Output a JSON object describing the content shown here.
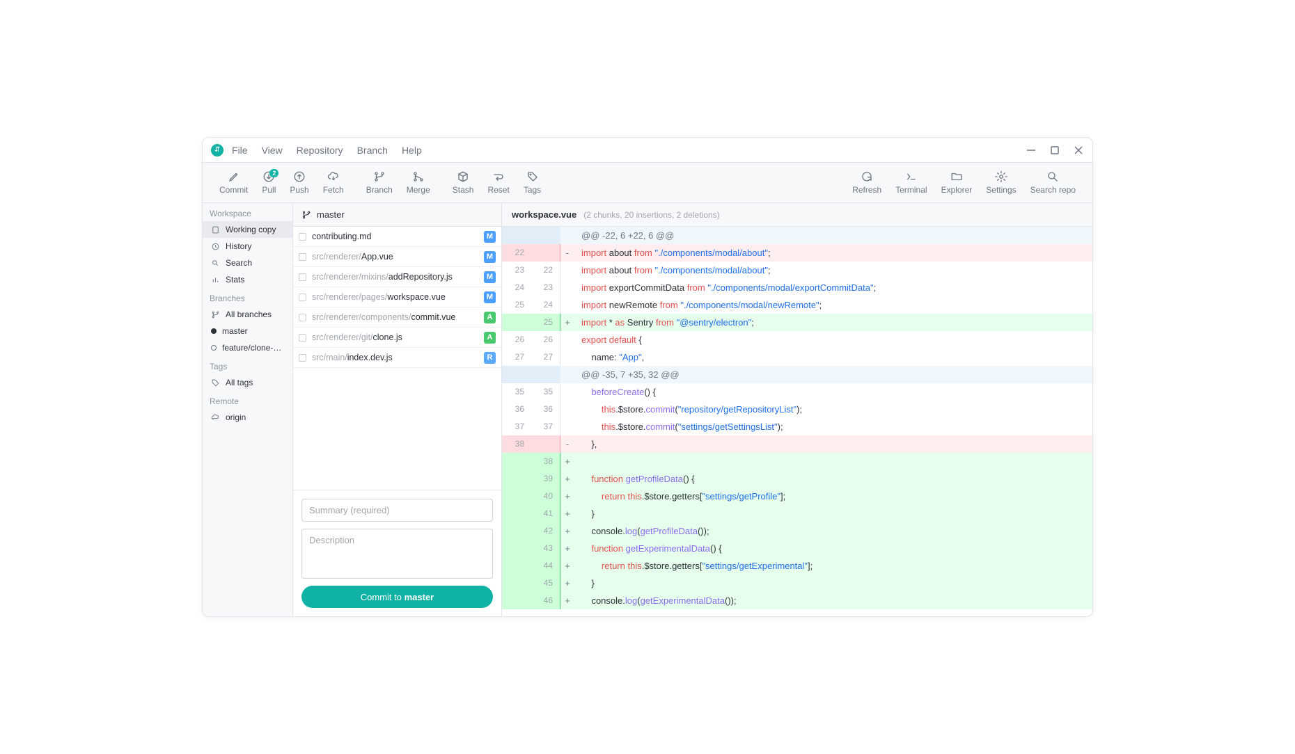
{
  "menu": {
    "file": "File",
    "view": "View",
    "repository": "Repository",
    "branch": "Branch",
    "help": "Help"
  },
  "toolbar": {
    "commit": "Commit",
    "pull": "Pull",
    "pull_badge": "2",
    "push": "Push",
    "fetch": "Fetch",
    "branch": "Branch",
    "merge": "Merge",
    "stash": "Stash",
    "reset": "Reset",
    "tags": "Tags",
    "refresh": "Refresh",
    "terminal": "Terminal",
    "explorer": "Explorer",
    "settings": "Settings",
    "search": "Search repo"
  },
  "sidebar": {
    "workspace_title": "Workspace",
    "working_copy": "Working copy",
    "history": "History",
    "search": "Search",
    "stats": "Stats",
    "branches_title": "Branches",
    "all_branches": "All branches",
    "branch_master": "master",
    "branch_feature": "feature/clone-re...",
    "tags_title": "Tags",
    "all_tags": "All tags",
    "remote_title": "Remote",
    "origin": "origin"
  },
  "filepanel": {
    "branch": "master",
    "files": [
      {
        "dim": "",
        "name": "contributing.md",
        "status": "M",
        "selected": false
      },
      {
        "dim": "src/renderer/",
        "name": "App.vue",
        "status": "M",
        "selected": true
      },
      {
        "dim": "src/renderer/mixins/",
        "name": "addRepository.js",
        "status": "M",
        "selected": false
      },
      {
        "dim": "src/renderer/pages/",
        "name": "workspace.vue",
        "status": "M",
        "selected": false
      },
      {
        "dim": "src/renderer/components/",
        "name": "commit.vue",
        "status": "A",
        "selected": false
      },
      {
        "dim": "src/renderer/git/",
        "name": "clone.js",
        "status": "A",
        "selected": false
      },
      {
        "dim": "src/main/",
        "name": "index.dev.js",
        "status": "R",
        "selected": false
      }
    ],
    "summary_ph": "Summary (required)",
    "desc_ph": "Description",
    "commit_prefix": "Commit to ",
    "commit_branch": "master"
  },
  "diff": {
    "filename": "workspace.vue",
    "meta": "(2 chunks, 20 insertions, 2 deletions)",
    "lines": [
      {
        "type": "hunk",
        "old": "",
        "new": "",
        "sign": "",
        "tokens": [
          {
            "cls": "tok-dim",
            "t": "@@ -22, 6 +22, 6 @@"
          }
        ]
      },
      {
        "type": "del",
        "old": "22",
        "new": "",
        "sign": "-",
        "tokens": [
          {
            "cls": "tok-kw",
            "t": "import"
          },
          {
            "cls": "tok-plain",
            "t": " about "
          },
          {
            "cls": "tok-kw",
            "t": "from"
          },
          {
            "cls": "tok-plain",
            "t": " "
          },
          {
            "cls": "tok-str",
            "t": "\"./components/modal/about\""
          },
          {
            "cls": "tok-plain",
            "t": ";"
          }
        ]
      },
      {
        "type": "ctx",
        "old": "23",
        "new": "22",
        "sign": "",
        "tokens": [
          {
            "cls": "tok-kw",
            "t": "import"
          },
          {
            "cls": "tok-plain",
            "t": " about "
          },
          {
            "cls": "tok-kw",
            "t": "from"
          },
          {
            "cls": "tok-plain",
            "t": " "
          },
          {
            "cls": "tok-str",
            "t": "\"./components/modal/about\""
          },
          {
            "cls": "tok-plain",
            "t": ";"
          }
        ]
      },
      {
        "type": "ctx",
        "old": "24",
        "new": "23",
        "sign": "",
        "tokens": [
          {
            "cls": "tok-kw",
            "t": "import"
          },
          {
            "cls": "tok-plain",
            "t": " exportCommitData "
          },
          {
            "cls": "tok-kw",
            "t": "from"
          },
          {
            "cls": "tok-plain",
            "t": " "
          },
          {
            "cls": "tok-str",
            "t": "\"./components/modal/exportCommitData\""
          },
          {
            "cls": "tok-plain",
            "t": ";"
          }
        ]
      },
      {
        "type": "ctx",
        "old": "25",
        "new": "24",
        "sign": "",
        "tokens": [
          {
            "cls": "tok-kw",
            "t": "import"
          },
          {
            "cls": "tok-plain",
            "t": " newRemote "
          },
          {
            "cls": "tok-kw",
            "t": "from"
          },
          {
            "cls": "tok-plain",
            "t": " "
          },
          {
            "cls": "tok-str",
            "t": "\"./components/modal/newRemote\""
          },
          {
            "cls": "tok-plain",
            "t": ";"
          }
        ]
      },
      {
        "type": "add",
        "old": "",
        "new": "25",
        "sign": "+",
        "tokens": [
          {
            "cls": "tok-kw",
            "t": "import"
          },
          {
            "cls": "tok-plain",
            "t": " * "
          },
          {
            "cls": "tok-kw",
            "t": "as"
          },
          {
            "cls": "tok-plain",
            "t": " Sentry "
          },
          {
            "cls": "tok-kw",
            "t": "from"
          },
          {
            "cls": "tok-plain",
            "t": " "
          },
          {
            "cls": "tok-str",
            "t": "\"@sentry/electron\""
          },
          {
            "cls": "tok-plain",
            "t": ";"
          }
        ]
      },
      {
        "type": "ctx",
        "old": "26",
        "new": "26",
        "sign": "",
        "tokens": [
          {
            "cls": "tok-kw",
            "t": "export default"
          },
          {
            "cls": "tok-plain",
            "t": " {"
          }
        ]
      },
      {
        "type": "ctx",
        "old": "27",
        "new": "27",
        "sign": "",
        "tokens": [
          {
            "cls": "tok-plain",
            "t": "    name: "
          },
          {
            "cls": "tok-str",
            "t": "\"App\""
          },
          {
            "cls": "tok-plain",
            "t": ","
          }
        ]
      },
      {
        "type": "hunk",
        "old": "",
        "new": "",
        "sign": "",
        "tokens": [
          {
            "cls": "tok-dim",
            "t": "@@ -35, 7 +35, 32 @@"
          }
        ]
      },
      {
        "type": "ctx",
        "old": "35",
        "new": "35",
        "sign": "",
        "tokens": [
          {
            "cls": "tok-plain",
            "t": "    "
          },
          {
            "cls": "tok-fn",
            "t": "beforeCreate"
          },
          {
            "cls": "tok-plain",
            "t": "() {"
          }
        ]
      },
      {
        "type": "ctx",
        "old": "36",
        "new": "36",
        "sign": "",
        "tokens": [
          {
            "cls": "tok-plain",
            "t": "        "
          },
          {
            "cls": "tok-kw",
            "t": "this"
          },
          {
            "cls": "tok-plain",
            "t": ".$store."
          },
          {
            "cls": "tok-fn",
            "t": "commit"
          },
          {
            "cls": "tok-plain",
            "t": "("
          },
          {
            "cls": "tok-str",
            "t": "\"repository/getRepositoryList\""
          },
          {
            "cls": "tok-plain",
            "t": ");"
          }
        ]
      },
      {
        "type": "ctx",
        "old": "37",
        "new": "37",
        "sign": "",
        "tokens": [
          {
            "cls": "tok-plain",
            "t": "        "
          },
          {
            "cls": "tok-kw",
            "t": "this"
          },
          {
            "cls": "tok-plain",
            "t": ".$store."
          },
          {
            "cls": "tok-fn",
            "t": "commit"
          },
          {
            "cls": "tok-plain",
            "t": "("
          },
          {
            "cls": "tok-str",
            "t": "\"settings/getSettingsList\""
          },
          {
            "cls": "tok-plain",
            "t": ");"
          }
        ]
      },
      {
        "type": "del",
        "old": "38",
        "new": "",
        "sign": "-",
        "tokens": [
          {
            "cls": "tok-plain",
            "t": "    },"
          }
        ]
      },
      {
        "type": "add",
        "old": "",
        "new": "38",
        "sign": "+",
        "tokens": []
      },
      {
        "type": "add",
        "old": "",
        "new": "39",
        "sign": "+",
        "tokens": [
          {
            "cls": "tok-plain",
            "t": "    "
          },
          {
            "cls": "tok-kw",
            "t": "function"
          },
          {
            "cls": "tok-plain",
            "t": " "
          },
          {
            "cls": "tok-fn",
            "t": "getProfileData"
          },
          {
            "cls": "tok-plain",
            "t": "() {"
          }
        ]
      },
      {
        "type": "add",
        "old": "",
        "new": "40",
        "sign": "+",
        "tokens": [
          {
            "cls": "tok-plain",
            "t": "        "
          },
          {
            "cls": "tok-kw",
            "t": "return this"
          },
          {
            "cls": "tok-plain",
            "t": ".$store.getters["
          },
          {
            "cls": "tok-str",
            "t": "\"settings/getProfile\""
          },
          {
            "cls": "tok-plain",
            "t": "];"
          }
        ]
      },
      {
        "type": "add",
        "old": "",
        "new": "41",
        "sign": "+",
        "tokens": [
          {
            "cls": "tok-plain",
            "t": "    }"
          }
        ]
      },
      {
        "type": "add",
        "old": "",
        "new": "42",
        "sign": "+",
        "tokens": [
          {
            "cls": "tok-plain",
            "t": "    console."
          },
          {
            "cls": "tok-fn",
            "t": "log"
          },
          {
            "cls": "tok-plain",
            "t": "("
          },
          {
            "cls": "tok-fn",
            "t": "getProfileData"
          },
          {
            "cls": "tok-plain",
            "t": "());"
          }
        ]
      },
      {
        "type": "add",
        "old": "",
        "new": "43",
        "sign": "+",
        "tokens": [
          {
            "cls": "tok-plain",
            "t": "    "
          },
          {
            "cls": "tok-kw",
            "t": "function"
          },
          {
            "cls": "tok-plain",
            "t": " "
          },
          {
            "cls": "tok-fn",
            "t": "getExperimentalData"
          },
          {
            "cls": "tok-plain",
            "t": "() {"
          }
        ]
      },
      {
        "type": "add",
        "old": "",
        "new": "44",
        "sign": "+",
        "tokens": [
          {
            "cls": "tok-plain",
            "t": "        "
          },
          {
            "cls": "tok-kw",
            "t": "return this"
          },
          {
            "cls": "tok-plain",
            "t": ".$store.getters["
          },
          {
            "cls": "tok-str",
            "t": "\"settings/getExperimental\""
          },
          {
            "cls": "tok-plain",
            "t": "];"
          }
        ]
      },
      {
        "type": "add",
        "old": "",
        "new": "45",
        "sign": "+",
        "tokens": [
          {
            "cls": "tok-plain",
            "t": "    }"
          }
        ]
      },
      {
        "type": "add",
        "old": "",
        "new": "46",
        "sign": "+",
        "tokens": [
          {
            "cls": "tok-plain",
            "t": "    console."
          },
          {
            "cls": "tok-fn",
            "t": "log"
          },
          {
            "cls": "tok-plain",
            "t": "("
          },
          {
            "cls": "tok-fn",
            "t": "getExperimentalData"
          },
          {
            "cls": "tok-plain",
            "t": "());"
          }
        ]
      }
    ]
  }
}
